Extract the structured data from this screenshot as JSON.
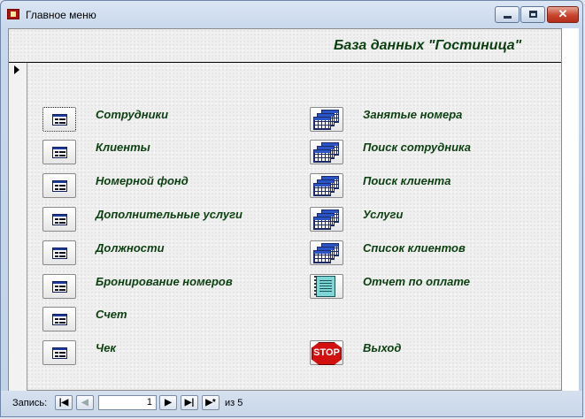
{
  "window": {
    "title": "Главное меню"
  },
  "form": {
    "header_title": "База данных \"Гостиница\"",
    "left_items": [
      {
        "label": "Сотрудники",
        "icon": "form-icon"
      },
      {
        "label": "Клиенты",
        "icon": "form-icon"
      },
      {
        "label": "Номерной фонд",
        "icon": "form-icon"
      },
      {
        "label": "Дополнительные услуги",
        "icon": "form-icon"
      },
      {
        "label": "Должности",
        "icon": "form-icon"
      },
      {
        "label": "Бронирование номеров",
        "icon": "form-icon"
      },
      {
        "label": "Счет",
        "icon": "form-icon"
      },
      {
        "label": "Чек",
        "icon": "form-icon"
      }
    ],
    "right_items": [
      {
        "label": "Занятые номера",
        "icon": "query-grid-icon"
      },
      {
        "label": "Поиск сотрудника",
        "icon": "query-grid-icon"
      },
      {
        "label": "Поиск клиента",
        "icon": "query-grid-icon"
      },
      {
        "label": "Услуги",
        "icon": "query-grid-icon"
      },
      {
        "label": "Список клиентов",
        "icon": "query-grid-icon"
      },
      {
        "label": "Отчет по оплате",
        "icon": "report-icon"
      },
      {
        "label": "Выход",
        "icon": "stop-icon",
        "icon_text": "STOP"
      }
    ]
  },
  "navigator": {
    "label": "Запись:",
    "current": "1",
    "of_label": "из",
    "total": "5"
  },
  "colors": {
    "label_text": "#0b3f10",
    "close_button": "#c8442d"
  }
}
